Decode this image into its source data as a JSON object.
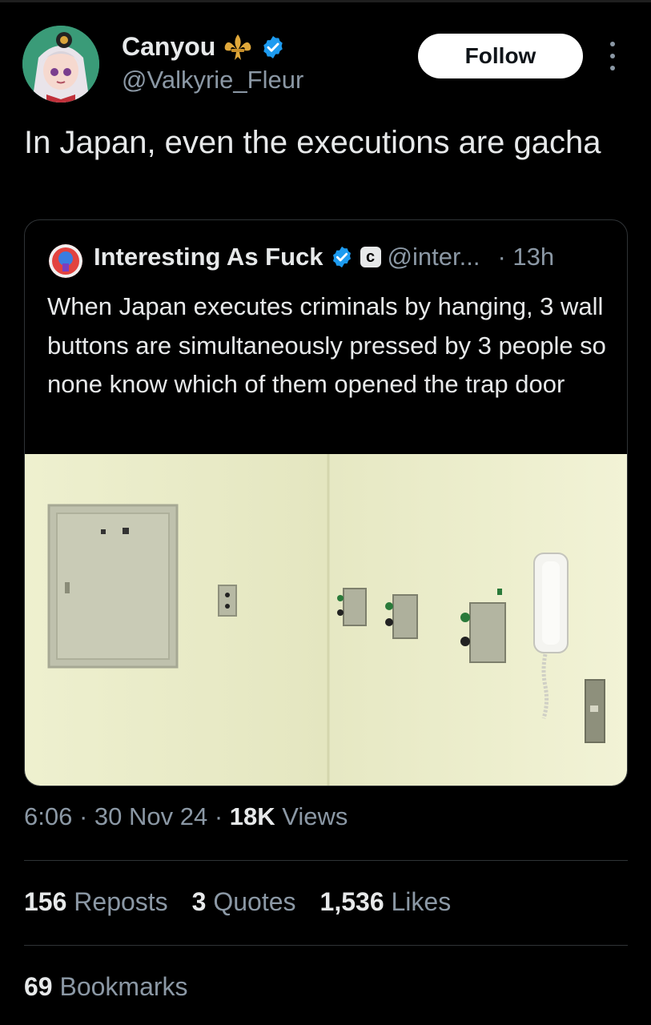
{
  "author": {
    "display_name": "Canyou",
    "handle": "@Valkyrie_Fleur",
    "avatar_icon": "anime-girl-avatar",
    "name_emoji_icon": "fleur-de-lis-icon",
    "verified": true
  },
  "follow_label": "Follow",
  "tweet_text": "In Japan, even the executions are gacha",
  "quoted": {
    "display_name": "Interesting As Fuck",
    "badge_letter": "c",
    "handle": "@inter...",
    "time": "· 13h",
    "text": "When Japan executes criminals by hanging, 3 wall buttons are simultaneously pressed by 3 people so none know which of them opened the trap door",
    "image_icon": "execution-room-wall-buttons-photo"
  },
  "meta": {
    "time": "6:06",
    "date": "30 Nov 24",
    "views_count": "18K",
    "views_label": "Views"
  },
  "stats": {
    "reposts_count": "156",
    "reposts_label": "Reposts",
    "quotes_count": "3",
    "quotes_label": "Quotes",
    "likes_count": "1,536",
    "likes_label": "Likes",
    "bookmarks_count": "69",
    "bookmarks_label": "Bookmarks"
  },
  "colors": {
    "background": "#000000",
    "text_primary": "#e7e9ea",
    "text_secondary": "#8b98a5",
    "verified_blue": "#1d9bf0",
    "border": "#2f3336"
  }
}
